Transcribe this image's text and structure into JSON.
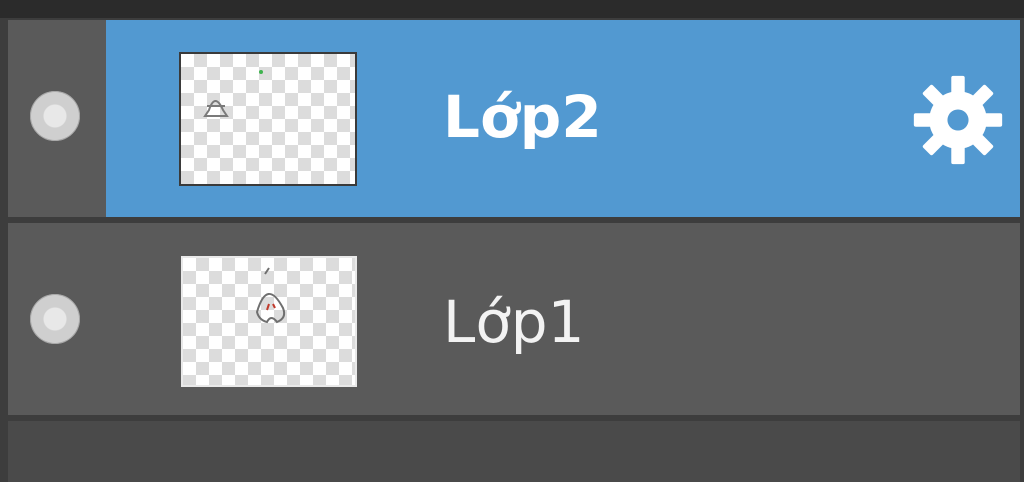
{
  "layers_panel": {
    "layers": [
      {
        "name": "Lớp2",
        "selected": true,
        "visible": true,
        "has_settings": true
      },
      {
        "name": "Lớp1",
        "selected": false,
        "visible": true,
        "has_settings": false
      }
    ],
    "icons": {
      "visibility": "visibility-toggle-icon",
      "settings": "gear-icon"
    },
    "colors": {
      "selected_row": "#5299d1",
      "row_background": "#5a5a5a",
      "panel_background": "#3d3d3d"
    }
  }
}
